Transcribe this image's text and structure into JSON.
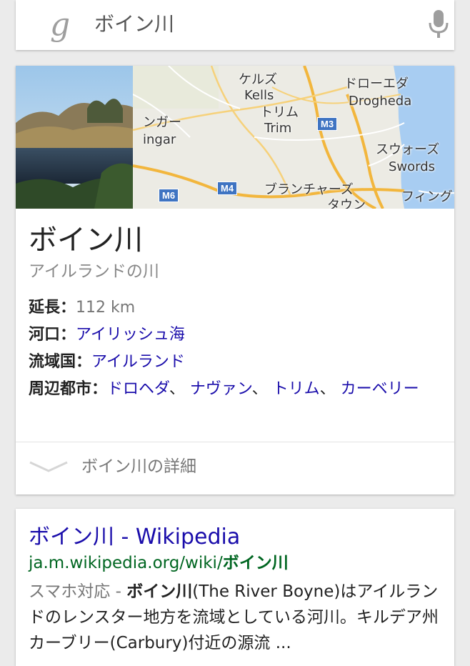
{
  "search": {
    "logo": "g",
    "query": "ボイン川"
  },
  "card": {
    "map_labels": [
      {
        "text": "ケルズ"
      },
      {
        "text": "Kells"
      },
      {
        "text": "ドローエダ"
      },
      {
        "text": "Drogheda"
      },
      {
        "text": "トリム"
      },
      {
        "text": "Trim"
      },
      {
        "text": "ンガー"
      },
      {
        "text": "ingar"
      },
      {
        "text": "スウォーズ"
      },
      {
        "text": "Swords"
      },
      {
        "text": "ブランチャーズ"
      },
      {
        "text": "タウン"
      },
      {
        "text": "フィングラ"
      }
    ],
    "road_badges": [
      "M3",
      "M4",
      "M6"
    ],
    "title": "ボイン川",
    "subtitle": "アイルランドの川",
    "facts": {
      "length_key": "延長：",
      "length_value": "112 km",
      "mouth_key": "河口：",
      "mouth_value": "アイリッシュ海",
      "country_key": "流域国：",
      "country_value": "アイルランド",
      "cities_key": "周辺都市：",
      "cities": [
        "ドロヘダ",
        "ナヴァン",
        "トリム",
        "カーベリー"
      ],
      "cities_sep": "、 "
    },
    "more_label": "ボイン川の詳細"
  },
  "result": {
    "title": "ボイン川 - Wikipedia",
    "url_prefix": "ja.m.wikipedia.org/wiki/",
    "url_bold": "ボイン川",
    "snippet_mobile": "スマホ対応 - ",
    "snippet_bold": "ボイン川",
    "snippet_rest": "(The River Boyne)はアイルランドのレンスター地方を流域としている河川。キルデア州カーブリー(Carbury)付近の源流 ..."
  },
  "colors": {
    "link": "#1a0dab",
    "url": "#006621",
    "background": "#ebebeb"
  }
}
